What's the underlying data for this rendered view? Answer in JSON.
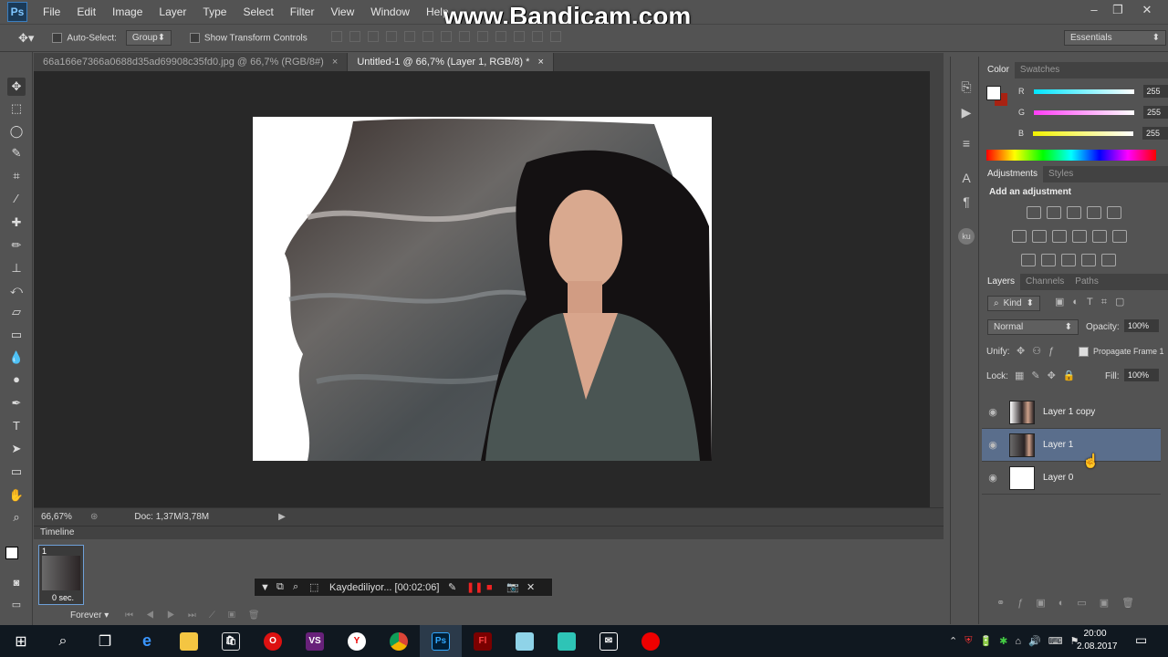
{
  "app": {
    "logo": "Ps"
  },
  "watermark": "www.Bandicam.com",
  "menu": [
    "File",
    "Edit",
    "Image",
    "Layer",
    "Type",
    "Select",
    "Filter",
    "View",
    "Window",
    "Help"
  ],
  "options_bar": {
    "auto_select_label": "Auto-Select:",
    "auto_select_value": "Group",
    "transform_label": "Show Transform Controls",
    "workspace": "Essentials"
  },
  "doc_tabs": [
    {
      "label": "66a166e7366a0688d35ad69908c35fd0.jpg @ 66,7% (RGB/8#)",
      "active": false
    },
    {
      "label": "Untitled-1 @ 66,7% (Layer 1, RGB/8) *",
      "active": true
    }
  ],
  "status": {
    "zoom": "66,67%",
    "doc": "Doc: 1,37M/3,78M"
  },
  "timeline": {
    "title": "Timeline",
    "frame_number": "1",
    "frame_delay": "0 sec.",
    "loop": "Forever"
  },
  "bandicam_bar": {
    "text": "Kaydediliyor... [00:02:06]"
  },
  "color_panel": {
    "tabs": [
      "Color",
      "Swatches"
    ],
    "sliders": [
      {
        "label": "R",
        "value": "255"
      },
      {
        "label": "G",
        "value": "255"
      },
      {
        "label": "B",
        "value": "255"
      }
    ],
    "colors": {
      "r": "#00e5ff",
      "g": "#ff3df5",
      "b": "#f2f200"
    }
  },
  "adjustments_panel": {
    "tabs": [
      "Adjustments",
      "Styles"
    ],
    "heading": "Add an adjustment"
  },
  "layers_panel": {
    "tabs": [
      "Layers",
      "Channels",
      "Paths"
    ],
    "kind": "Kind",
    "blend_mode": "Normal",
    "opacity_label": "Opacity:",
    "opacity": "100%",
    "unify_label": "Unify:",
    "propagate_label": "Propagate Frame 1",
    "lock_label": "Lock:",
    "fill_label": "Fill:",
    "fill": "100%",
    "layers": [
      {
        "name": "Layer 1 copy",
        "selected": false
      },
      {
        "name": "Layer 1",
        "selected": true
      },
      {
        "name": "Layer 0",
        "selected": false
      }
    ]
  },
  "taskbar": {
    "time": "20:00",
    "date": "2.08.2017",
    "apps": [
      "windows-icon",
      "search-icon",
      "task-view-icon",
      "edge-icon",
      "file-explorer-icon",
      "store-icon",
      "opera-icon",
      "visual-studio-icon",
      "yandex-icon",
      "chrome-icon",
      "photoshop-icon",
      "flash-icon",
      "app-icon",
      "app2-icon",
      "mail-icon",
      "bandicam-icon"
    ]
  }
}
